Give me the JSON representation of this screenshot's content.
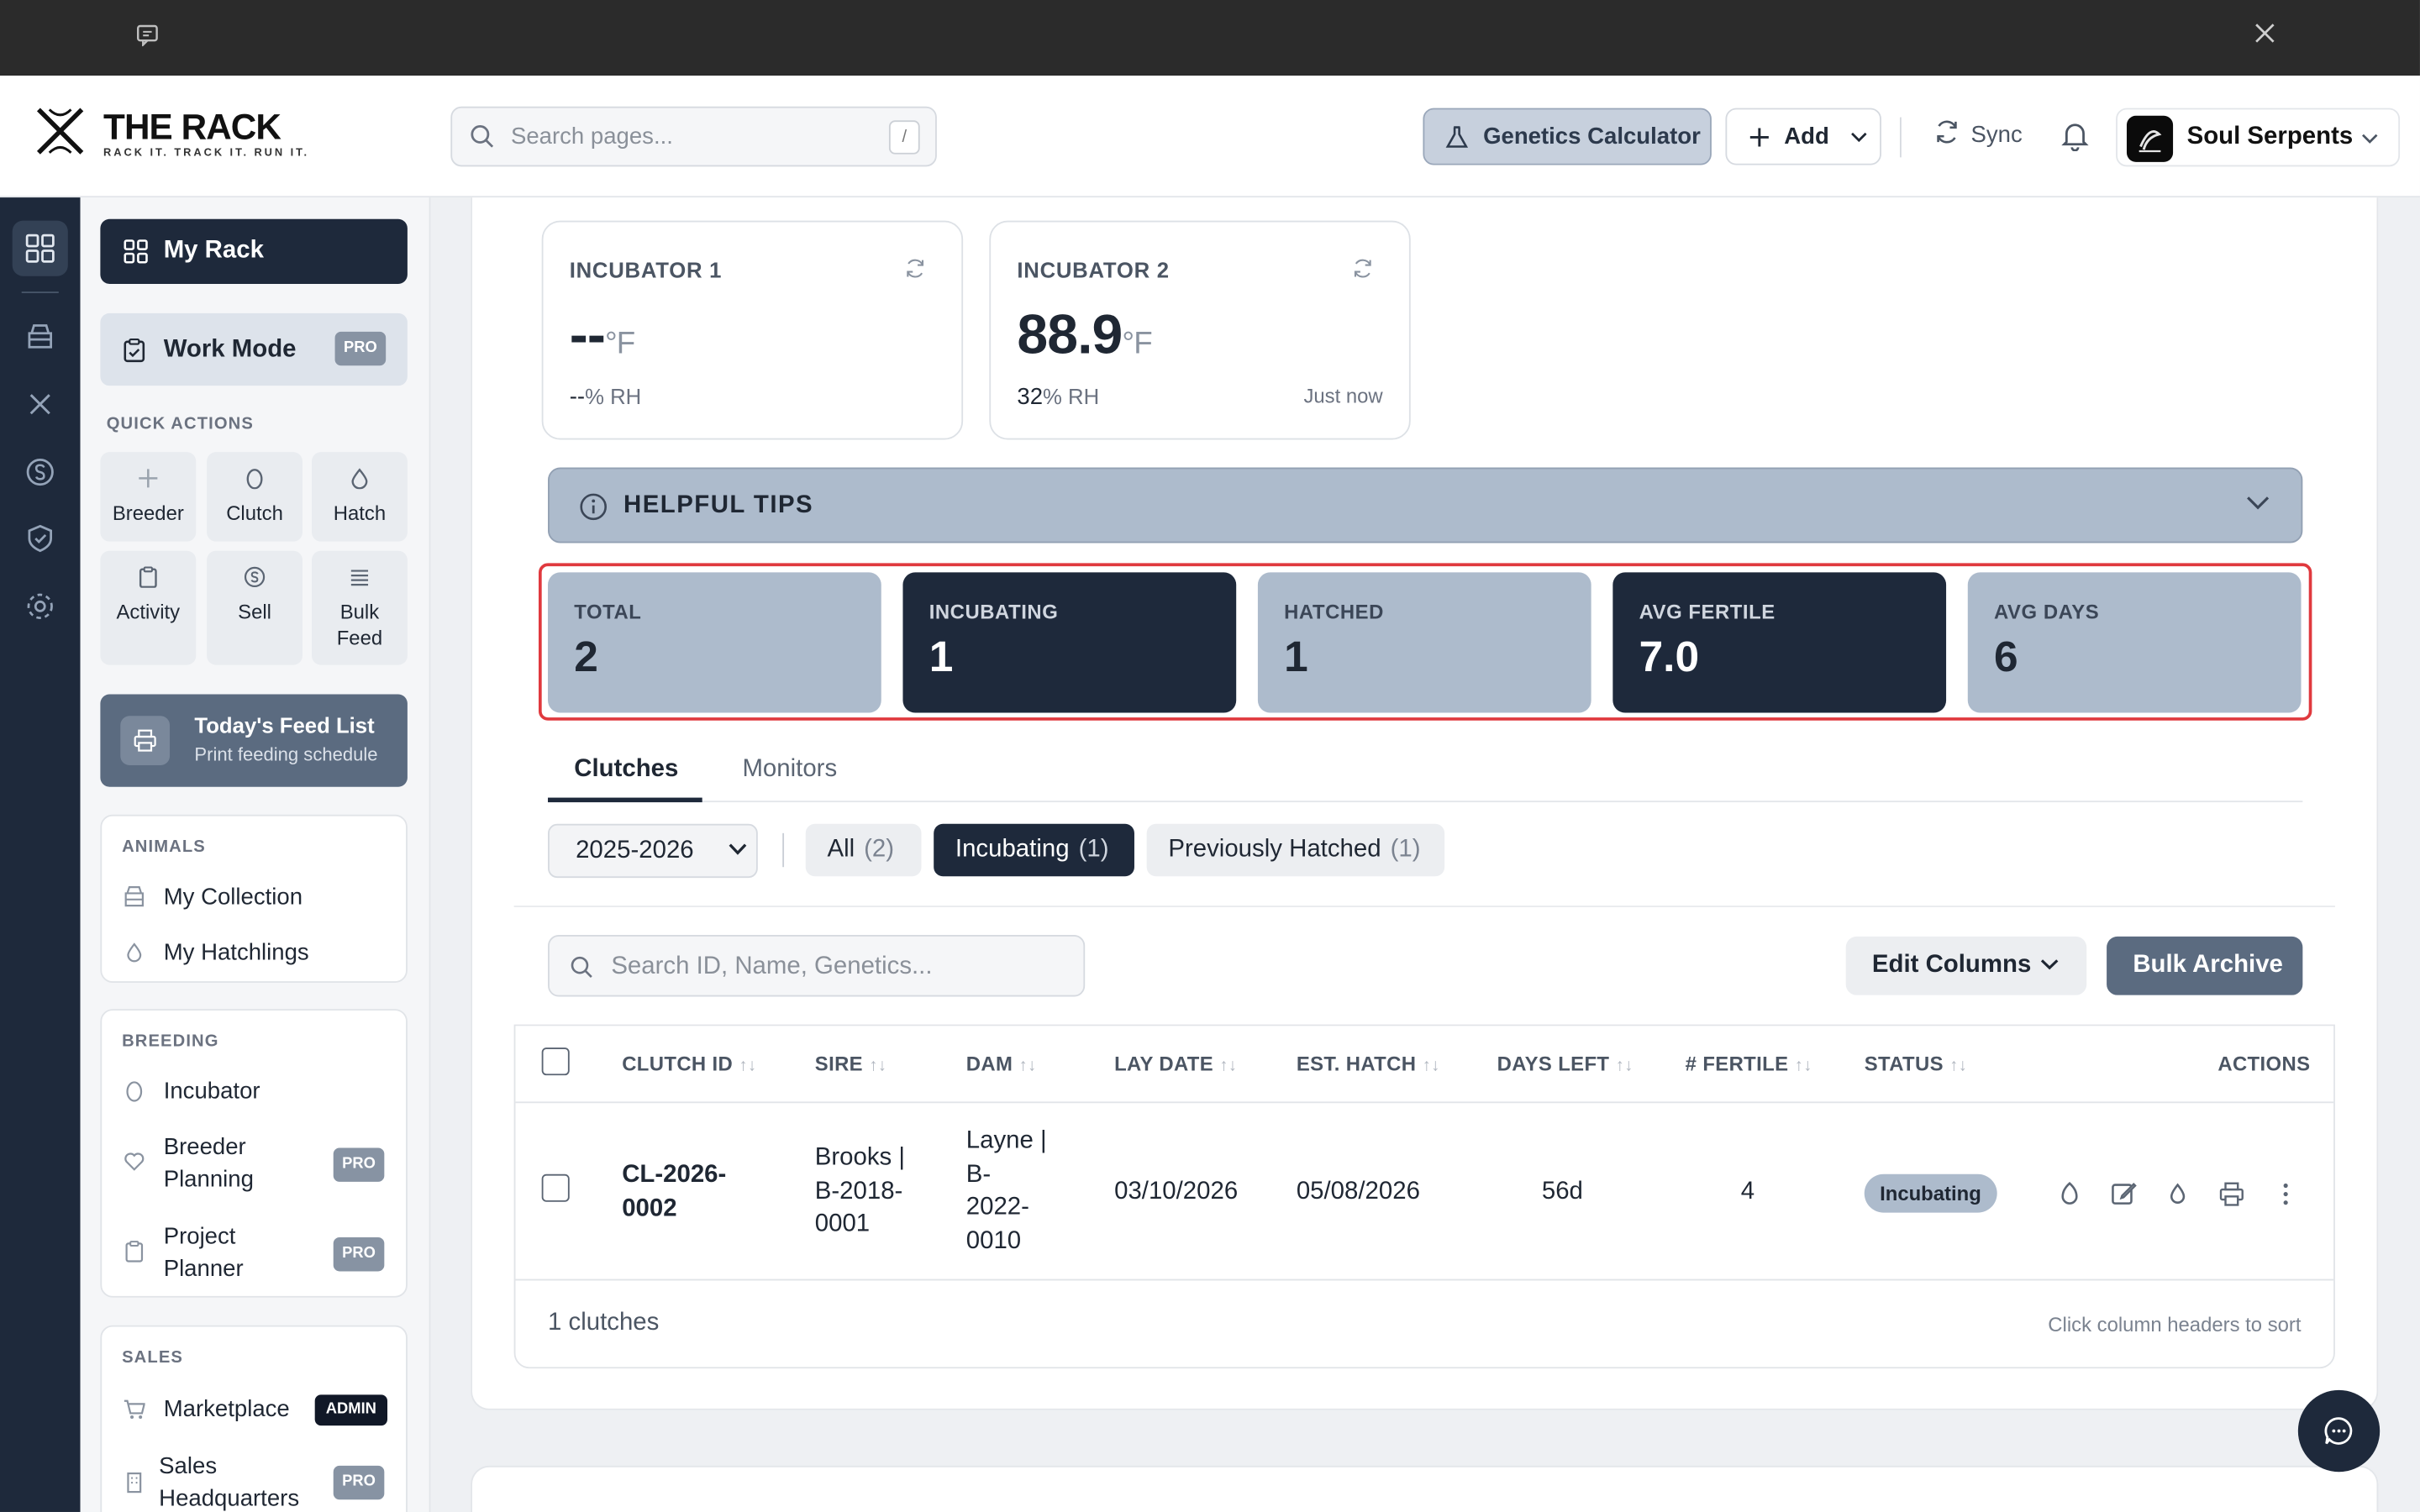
{
  "header": {
    "brand_title": "THE RACK",
    "brand_tagline": "RACK IT. TRACK IT. RUN IT.",
    "search_placeholder": "Search pages...",
    "search_shortcut": "/",
    "genetics_label": "Genetics Calculator",
    "add_label": "Add",
    "sync_label": "Sync",
    "account_name": "Soul Serpents"
  },
  "sidebar": {
    "my_rack": "My Rack",
    "work_mode": "Work Mode",
    "pro_badge": "PRO",
    "admin_badge": "ADMIN",
    "quick_actions_label": "QUICK ACTIONS",
    "quick_actions": [
      {
        "label": "Breeder",
        "icon": "plus-icon"
      },
      {
        "label": "Clutch",
        "icon": "egg-icon"
      },
      {
        "label": "Hatch",
        "icon": "drop-icon"
      },
      {
        "label": "Activity",
        "icon": "clipboard-icon"
      },
      {
        "label": "Sell",
        "icon": "dollar-icon"
      },
      {
        "label": "Bulk Feed",
        "icon": "list-icon"
      }
    ],
    "feed_list": {
      "title": "Today's Feed List",
      "subtitle": "Print feeding schedule"
    },
    "animals": {
      "label": "ANIMALS",
      "items": [
        "My Collection",
        "My Hatchlings"
      ]
    },
    "breeding": {
      "label": "BREEDING",
      "items": [
        "Incubator",
        "Breeder Planning",
        "Project Planner"
      ]
    },
    "sales": {
      "label": "SALES",
      "items": [
        "Marketplace",
        "Sales Headquarters"
      ]
    }
  },
  "incubators": [
    {
      "name": "INCUBATOR 1",
      "temp": "--",
      "unit": "°F",
      "rh_value": "--",
      "rh_unit": "% RH",
      "updated": ""
    },
    {
      "name": "INCUBATOR 2",
      "temp": "88.9",
      "unit": "°F",
      "rh_value": "32",
      "rh_unit": "% RH",
      "updated": "Just now"
    }
  ],
  "tips": {
    "label": "HELPFUL TIPS"
  },
  "stats": [
    {
      "label": "TOTAL",
      "value": "2"
    },
    {
      "label": "INCUBATING",
      "value": "1"
    },
    {
      "label": "HATCHED",
      "value": "1"
    },
    {
      "label": "AVG FERTILE",
      "value": "7.0"
    },
    {
      "label": "AVG DAYS",
      "value": "6"
    }
  ],
  "tabs": [
    "Clutches",
    "Monitors"
  ],
  "filters": {
    "season": "2025-2026",
    "pills": [
      {
        "label": "All",
        "count": "(2)"
      },
      {
        "label": "Incubating",
        "count": "(1)"
      },
      {
        "label": "Previously Hatched",
        "count": "(1)"
      }
    ]
  },
  "toolbar": {
    "search_placeholder": "Search ID, Name, Genetics...",
    "edit_columns": "Edit Columns",
    "bulk_archive": "Bulk Archive"
  },
  "table": {
    "columns": [
      "CLUTCH ID",
      "SIRE",
      "DAM",
      "LAY DATE",
      "EST. HATCH",
      "DAYS LEFT",
      "# FERTILE",
      "STATUS",
      "ACTIONS"
    ],
    "sort_glyph": "↑↓",
    "rows": [
      {
        "clutch_id": [
          "CL-2026-",
          "0002"
        ],
        "sire": [
          "Brooks |",
          "B-2018-",
          "0001"
        ],
        "dam": [
          "Layne |",
          "B-",
          "2022-",
          "0010"
        ],
        "lay_date": "03/10/2026",
        "est_hatch": "05/08/2026",
        "days_left": "56d",
        "fertile": "4",
        "status": "Incubating"
      }
    ],
    "footer_count": "1 clutches",
    "footer_hint": "Click column headers to sort"
  }
}
